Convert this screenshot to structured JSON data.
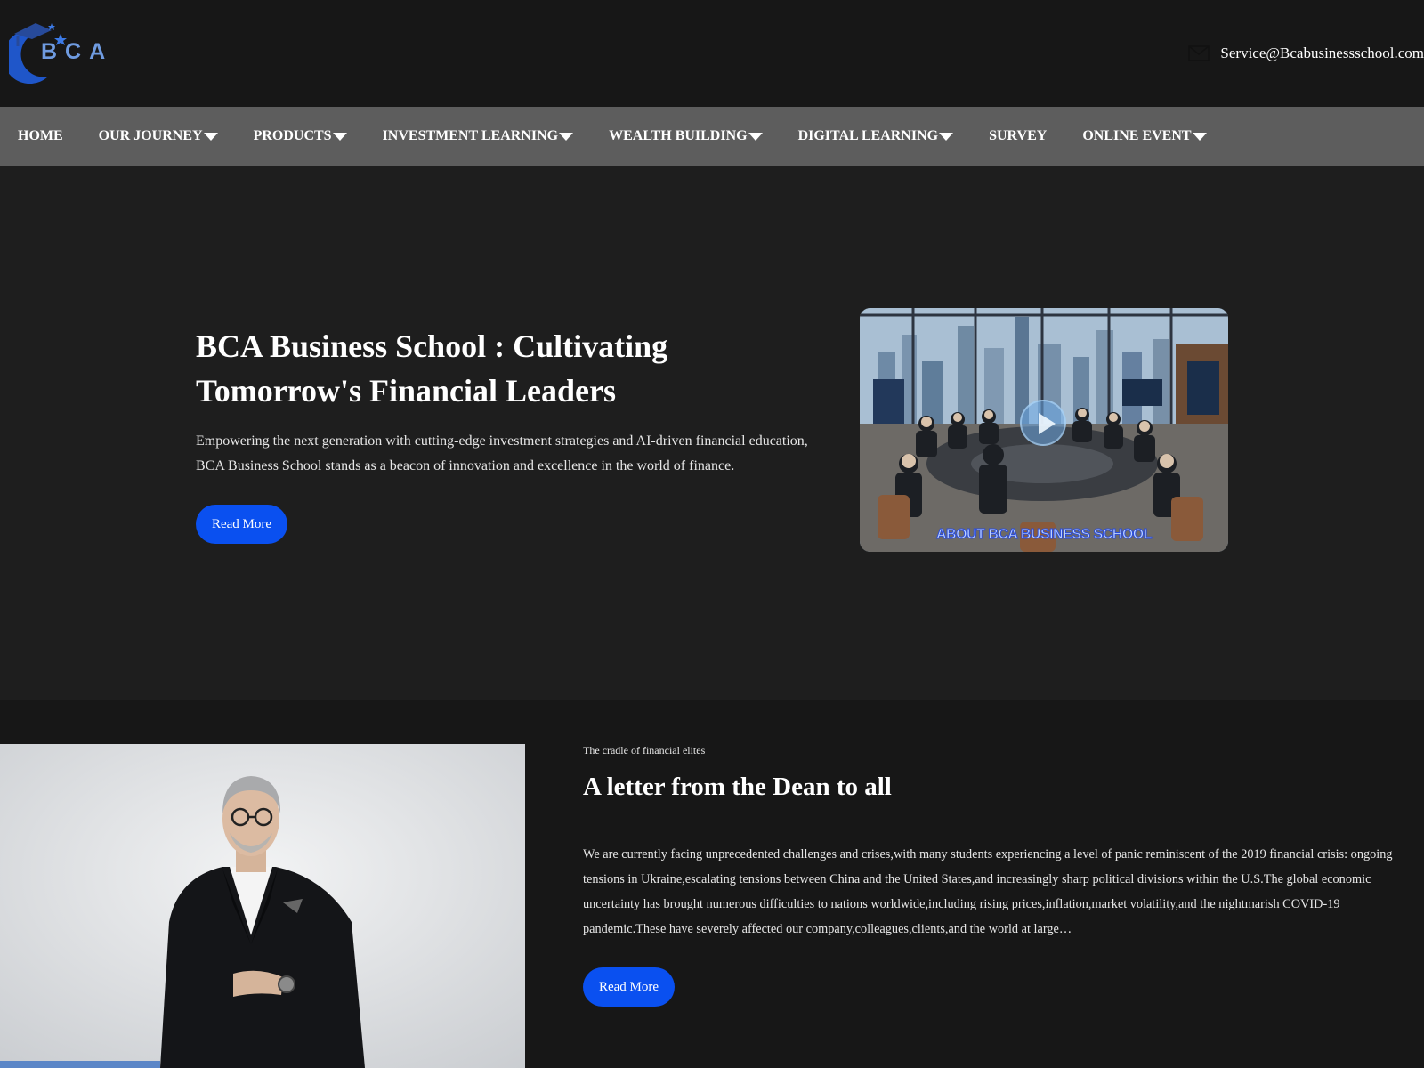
{
  "brand": {
    "logo_text": "BCA",
    "accent_color": "#0a50f0"
  },
  "header": {
    "email": "Service@Bcabusinessschool.com",
    "email_icon": "mail-icon"
  },
  "nav": {
    "items": [
      {
        "label": "HOME",
        "has_dropdown": false
      },
      {
        "label": "OUR JOURNEY",
        "has_dropdown": true
      },
      {
        "label": "PRODUCTS",
        "has_dropdown": true
      },
      {
        "label": "INVESTMENT LEARNING",
        "has_dropdown": true
      },
      {
        "label": "WEALTH BUILDING",
        "has_dropdown": true
      },
      {
        "label": "DIGITAL LEARNING",
        "has_dropdown": true
      },
      {
        "label": "SURVEY",
        "has_dropdown": false
      },
      {
        "label": "ONLINE EVENT",
        "has_dropdown": true
      }
    ]
  },
  "hero": {
    "title": "BCA Business School : Cultivating Tomorrow's Financial Leaders",
    "description": "Empowering the next generation with cutting-edge investment strategies and AI-driven financial education, BCA Business School stands as a beacon of innovation and excellence in the world of finance.",
    "button_label": "Read More",
    "video_caption": "ABOUT BCA BUSINESS SCHOOL",
    "play_icon": "play-icon"
  },
  "dean": {
    "eyebrow": "The cradle of financial elites",
    "title": "A letter from the Dean to all",
    "letter": "We are currently facing unprecedented challenges and crises,with many students experiencing a level of panic reminiscent of the 2019 financial crisis: ongoing tensions in Ukraine,escalating tensions between China and the United States,and increasingly sharp political divisions within the U.S.The global economic uncertainty has brought numerous difficulties to nations worldwide,including rising prices,inflation,market volatility,and the nightmarish COVID-19 pandemic.These have severely affected our company,colleagues,clients,and the world at large…",
    "button_label": "Read More"
  }
}
